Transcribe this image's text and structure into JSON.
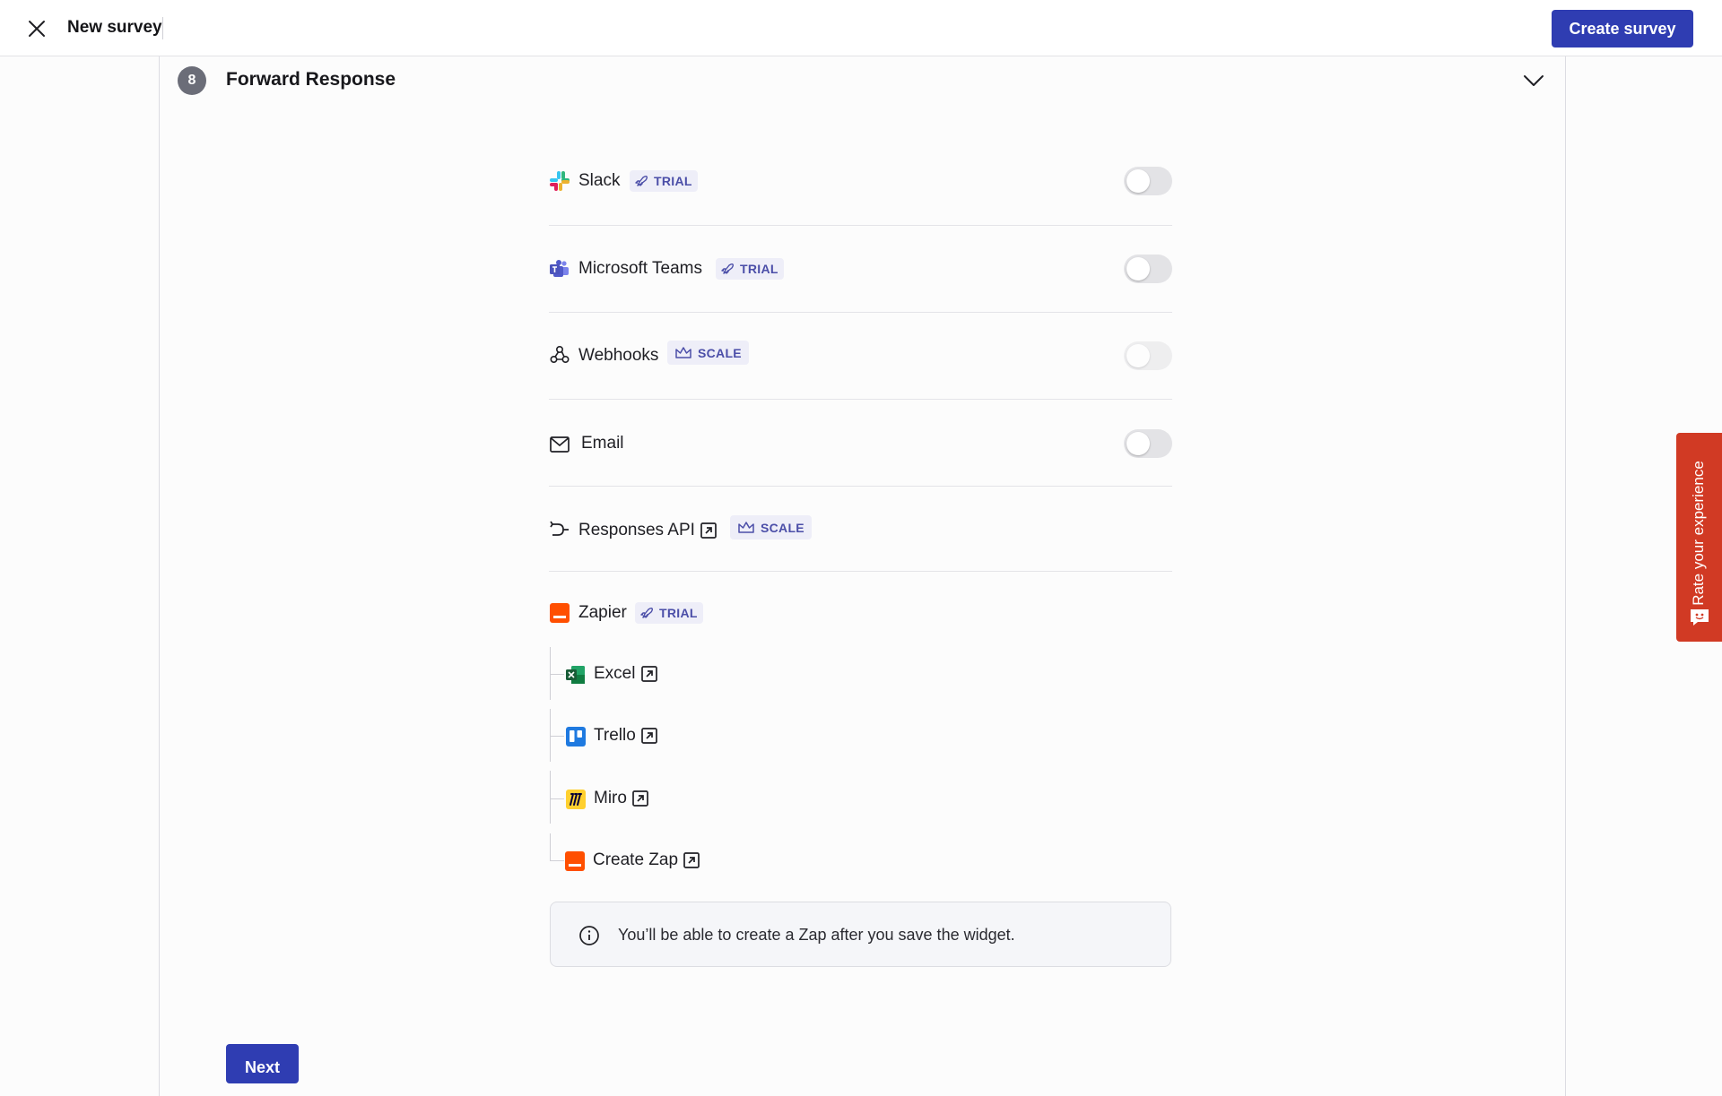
{
  "header": {
    "title": "New survey",
    "create_button": "Create survey"
  },
  "section": {
    "step": "8",
    "title": "Forward Response"
  },
  "integrations": [
    {
      "name": "Slack",
      "icon": "slack-icon",
      "badge": "TRIAL",
      "badge_icon": "rocket-icon",
      "toggle": "off"
    },
    {
      "name": "Microsoft Teams",
      "icon": "microsoft-teams-icon",
      "badge": "TRIAL",
      "badge_icon": "rocket-icon",
      "toggle": "off"
    },
    {
      "name": "Webhooks",
      "icon": "webhooks-icon",
      "badge": "SCALE",
      "badge_icon": "crown-icon",
      "toggle": "off (disabled)"
    },
    {
      "name": "Email",
      "icon": "mail-icon",
      "toggle": "off"
    },
    {
      "name": "Responses API",
      "icon": "api-icon",
      "badge": "SCALE",
      "badge_icon": "crown-icon",
      "external_link": true
    }
  ],
  "zapier": {
    "name": "Zapier",
    "badge": "TRIAL",
    "children": [
      {
        "name": "Excel",
        "icon": "excel-icon"
      },
      {
        "name": "Trello",
        "icon": "trello-icon"
      },
      {
        "name": "Miro",
        "icon": "miro-icon"
      },
      {
        "name": "Create Zap",
        "icon": "zapier-icon"
      }
    ]
  },
  "info": {
    "text": "You’ll be able to create a Zap after you save the widget."
  },
  "next_button": "Next",
  "feedback_tab": "Rate your experience",
  "colors": {
    "primary": "#2f3db2",
    "badge_bg": "#eeeef8",
    "badge_text": "#4b4ea8",
    "feedback": "#d13a24",
    "zapier": "#ff4f00"
  }
}
